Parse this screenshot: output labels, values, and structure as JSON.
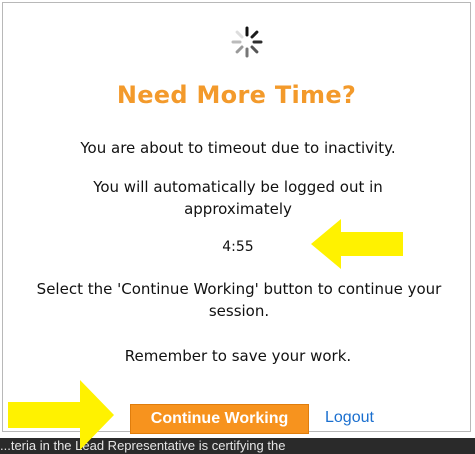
{
  "dialog": {
    "title": "Need More Time?",
    "message_timeout": "You are about to timeout due to inactivity.",
    "message_logout": "You will automatically be logged out in approximately",
    "countdown": "4:55",
    "message_continue": "Select the 'Continue Working' button to continue your session.",
    "message_save": "Remember to save your work.",
    "continue_label": "Continue Working",
    "logout_label": "Logout"
  },
  "background_text": "...teria in the Lead Representative is certifying the",
  "colors": {
    "accent": "#f39a2b",
    "button": "#f7931e",
    "link": "#1a6fcf",
    "highlight_arrow": "#fff200"
  },
  "icons": [
    "loading-spinner-icon",
    "pointer-arrow-icon"
  ]
}
